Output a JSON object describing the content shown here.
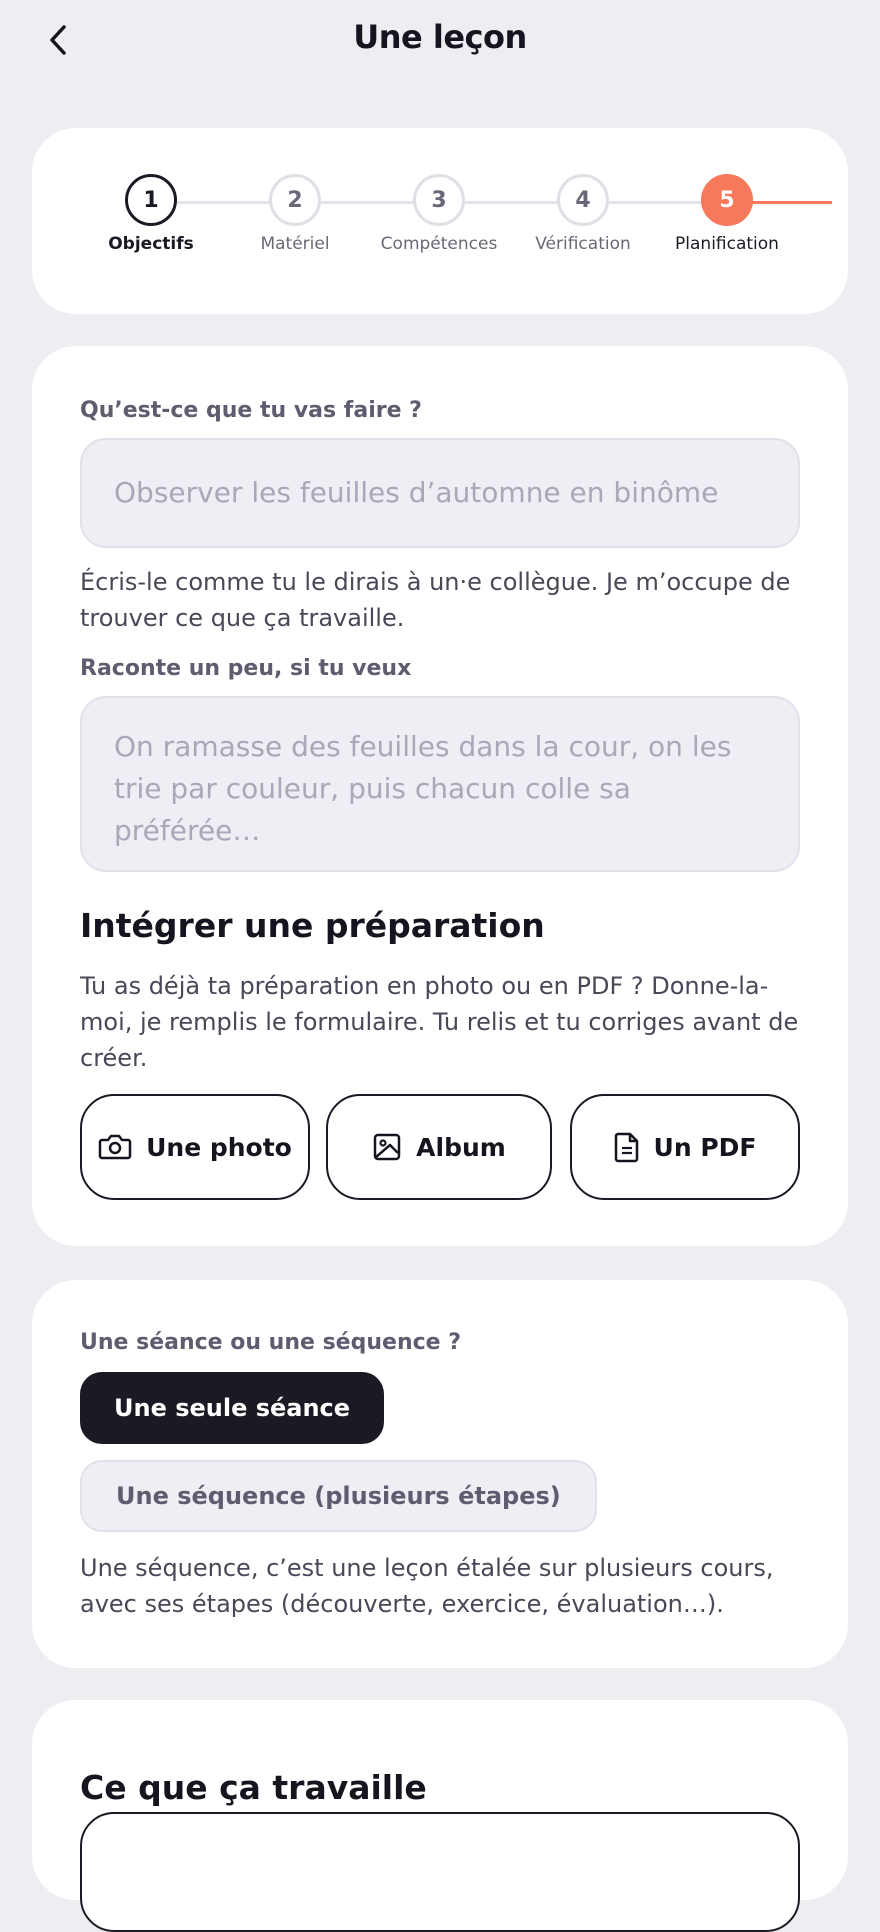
{
  "header": {
    "title": "Une leçon",
    "back_icon": "chevron-left-icon"
  },
  "stepper": {
    "steps": [
      {
        "number": "1",
        "label": "Objectifs",
        "state": "active"
      },
      {
        "number": "2",
        "label": "Matériel",
        "state": "pending"
      },
      {
        "number": "3",
        "label": "Compétences",
        "state": "pending"
      },
      {
        "number": "4",
        "label": "Vérification",
        "state": "pending"
      },
      {
        "number": "5",
        "label": "Planification",
        "state": "current"
      }
    ],
    "accent_color": "#f8785c"
  },
  "form": {
    "what_label": "Qu’est-ce que tu vas faire ?",
    "what_placeholder": "Observer les feuilles d’automne en binôme",
    "what_helper": "Écris-le comme tu le dirais à un·e collègue. Je m’occupe de trouver ce que ça travaille.",
    "story_label": "Raconte un peu, si tu veux",
    "story_placeholder": "On ramasse des feuilles dans la cour, on les trie par couleur, puis chacun colle sa préférée…",
    "import_title": "Intégrer une préparation",
    "import_helper": "Tu as déjà ta préparation en photo ou en PDF ? Donne-la-moi, je remplis le formulaire. Tu relis et tu corriges avant de créer.",
    "buttons": [
      {
        "label": "Une photo",
        "icon": "camera-icon"
      },
      {
        "label": "Album",
        "icon": "image-icon"
      },
      {
        "label": "Un PDF",
        "icon": "document-icon"
      }
    ]
  },
  "seance": {
    "label": "Une séance ou une séquence ?",
    "options": [
      {
        "label": "Une seule séance",
        "selected": true
      },
      {
        "label": "Une séquence (plusieurs étapes)",
        "selected": false
      }
    ],
    "helper": "Une séquence, c’est une leçon étalée sur plusieurs cours, avec ses étapes (découverte, exercice, évaluation…)."
  },
  "works": {
    "title": "Ce que ça travaille"
  }
}
